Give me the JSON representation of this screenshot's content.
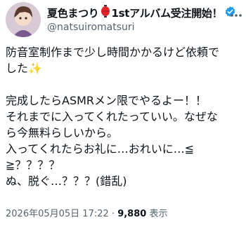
{
  "author": {
    "display_name": "夏色まつり",
    "badge_text": "1stアルバム受注開始！",
    "handle": "@natsuiromatsuri",
    "verified": true,
    "avatar_icon": "avatar-image",
    "lantern_icon": "lantern-icon",
    "verified_icon": "verified-badge-icon"
  },
  "tweet": {
    "lines": [
      "防音室制作まで少し時間かかるけど依頼で",
      "した✨",
      "",
      "完成したらASMRメン限でやるよー！！",
      "それまでに入ってくれたっていい。なぜな",
      "ら今無料らしいから。",
      "入ってくれたらお礼に…おれいに…≦",
      "≧？？？？",
      "ぬ、脱ぐ…？？？(錯乱)"
    ]
  },
  "meta": {
    "datetime": "2026年05月05日 17:22",
    "separator": "·",
    "views_count": "9,880",
    "views_label": "表示"
  },
  "colors": {
    "text": "#0f1419",
    "secondary": "#536471",
    "verified": "#1d9bf0"
  }
}
